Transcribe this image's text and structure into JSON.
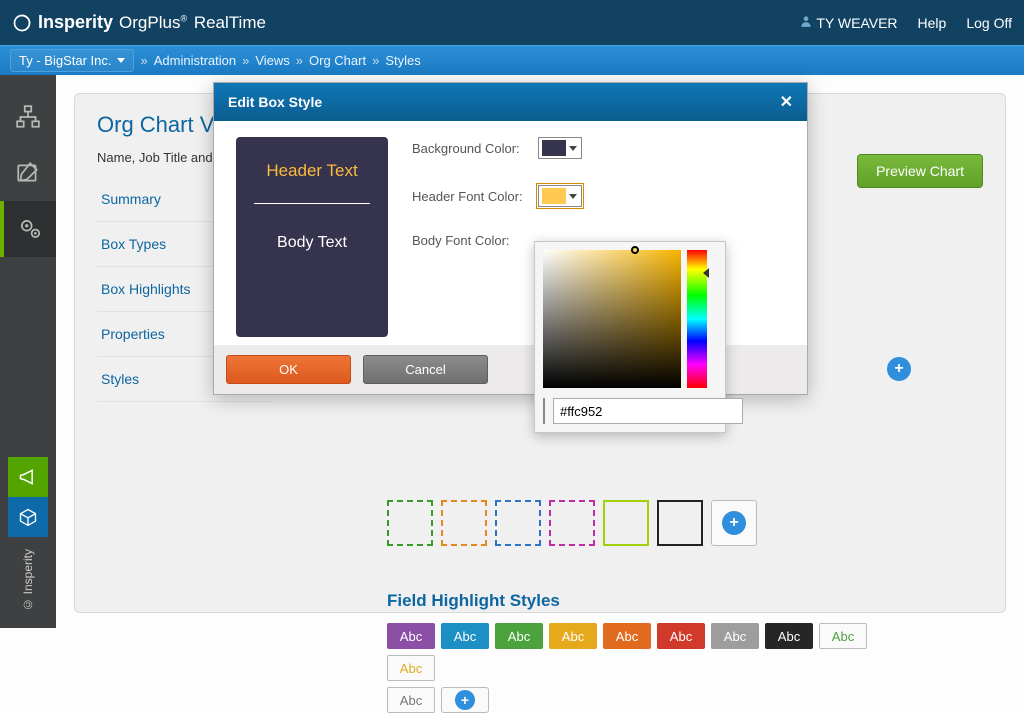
{
  "header": {
    "brand_strong": "Insperity",
    "brand_sub": "OrgPlus",
    "brand_rt": "RealTime",
    "trademark": "®",
    "user_name": "TY WEAVER",
    "help": "Help",
    "logoff": "Log Off"
  },
  "breadcrumb": {
    "org": "Ty - BigStar Inc.",
    "items": [
      "Administration",
      "Views",
      "Org Chart",
      "Styles"
    ]
  },
  "panel": {
    "title": "Org Chart View",
    "subtitle": "Name, Job Title and",
    "preview_btn": "Preview Chart"
  },
  "side_menu": [
    "Summary",
    "Box Types",
    "Box Highlights",
    "Properties",
    "Styles"
  ],
  "field_highlights": {
    "title": "Field Highlight Styles",
    "abc_label": "Abc",
    "colors": [
      "#8b4fa5",
      "#1c90c5",
      "#4ca23c",
      "#e6a91c",
      "#e06a1e",
      "#d13a2a",
      "#9d9d9d",
      "#262626"
    ],
    "outline_colors": [
      "#4ca23c",
      "#e6a91c"
    ]
  },
  "modal": {
    "title": "Edit Box Style",
    "preview": {
      "header": "Header Text",
      "body": "Body Text"
    },
    "rows": {
      "bg": {
        "label": "Background Color:",
        "color": "#35334d"
      },
      "header": {
        "label": "Header Font Color:",
        "color": "#ffc952"
      },
      "body": {
        "label": "Body Font Color:"
      }
    },
    "ok": "OK",
    "cancel": "Cancel"
  },
  "picker": {
    "hex": "#ffc952",
    "swatch_color": "#ffc952"
  },
  "copyright": "© Insperity"
}
